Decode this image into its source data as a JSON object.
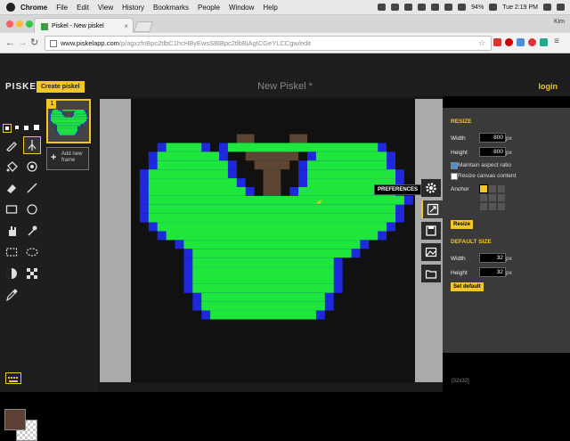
{
  "menubar": {
    "app": "Chrome",
    "items": [
      "File",
      "Edit",
      "View",
      "History",
      "Bookmarks",
      "People",
      "Window",
      "Help"
    ],
    "battery": "94%",
    "clock": "Tue 2:19 PM"
  },
  "browser": {
    "tab_title": "Piskel - New piskel",
    "profile": "Kim",
    "url_host": "www.piskelapp.com",
    "url_path": "/p/agxzfnBpc2tlbC1hcHByEwsSBlBpc2tlbBiAgICGeYLCCgw/edit"
  },
  "piskel": {
    "logo": "PISKEL",
    "create_button": "Create piskel",
    "title": "New Piskel *",
    "login": "login",
    "frame_number": "1",
    "add_frame": "Add new frame",
    "size_label": "[32x32]",
    "tooltip": "PREFERENCES"
  },
  "resize_panel": {
    "heading": "RESIZE",
    "width_label": "Width",
    "width_value": "800",
    "height_label": "Height",
    "height_value": "800",
    "unit": "px",
    "maintain_aspect": "Maintain aspect ratio",
    "resize_content": "Resize canvas content",
    "anchor_label": "Anchor",
    "resize_button": "Resize",
    "default_heading": "DEFAULT SIZE",
    "default_width_label": "Width",
    "default_width_value": "32",
    "default_height_label": "Height",
    "default_height_value": "32",
    "set_default_button": "Set default"
  },
  "colors": {
    "accent": "#f3c627",
    "primary_color": "#5c4033",
    "sprite_green": "#1ee63c",
    "sprite_blue": "#1e28dc",
    "sprite_brown": "#5c4633"
  },
  "icons": [
    "pen-icon",
    "vertical-mirror-pen-icon",
    "paint-bucket-icon",
    "paint-all-icon",
    "eraser-icon",
    "stroke-icon",
    "rectangle-icon",
    "circle-icon",
    "move-icon",
    "shape-select-icon",
    "rect-select-icon",
    "lasso-select-icon",
    "lighten-icon",
    "dithering-icon",
    "color-picker-icon",
    "settings-icon",
    "resize-icon",
    "save-icon",
    "export-image-icon",
    "import-icon",
    "keyboard-icon"
  ]
}
